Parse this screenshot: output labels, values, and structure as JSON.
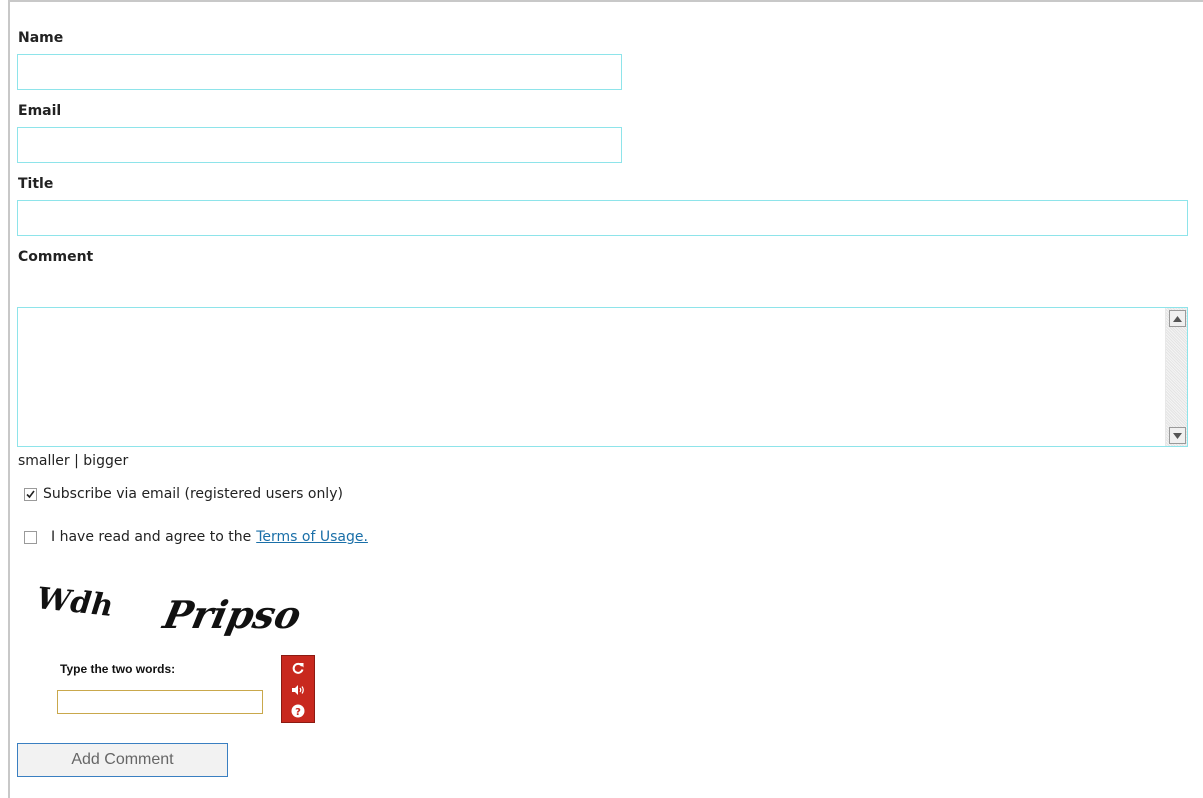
{
  "form": {
    "name_label": "Name",
    "name_value": "",
    "email_label": "Email",
    "email_value": "",
    "title_label": "Title",
    "title_value": "",
    "comment_label": "Comment",
    "comment_value": "",
    "sizer": {
      "smaller": "smaller",
      "separator": " | ",
      "bigger": "bigger"
    },
    "subscribe": {
      "label": "Subscribe via email (registered users only)",
      "checked": true
    },
    "terms": {
      "label": "I have read and agree to the",
      "link": "Terms of Usage.",
      "checked": false
    }
  },
  "captcha": {
    "words": [
      "Wdh",
      "Pripso"
    ],
    "prompt": "Type the two words:",
    "input_value": "",
    "tools": [
      "refresh-icon",
      "audio-icon",
      "help-icon"
    ],
    "tools_color": "#c8281e"
  },
  "submit": {
    "label": "Add Comment"
  },
  "colors": {
    "field_border": "#8ee4ea",
    "link": "#1a6fa8",
    "button_border": "#3a7fc1"
  }
}
